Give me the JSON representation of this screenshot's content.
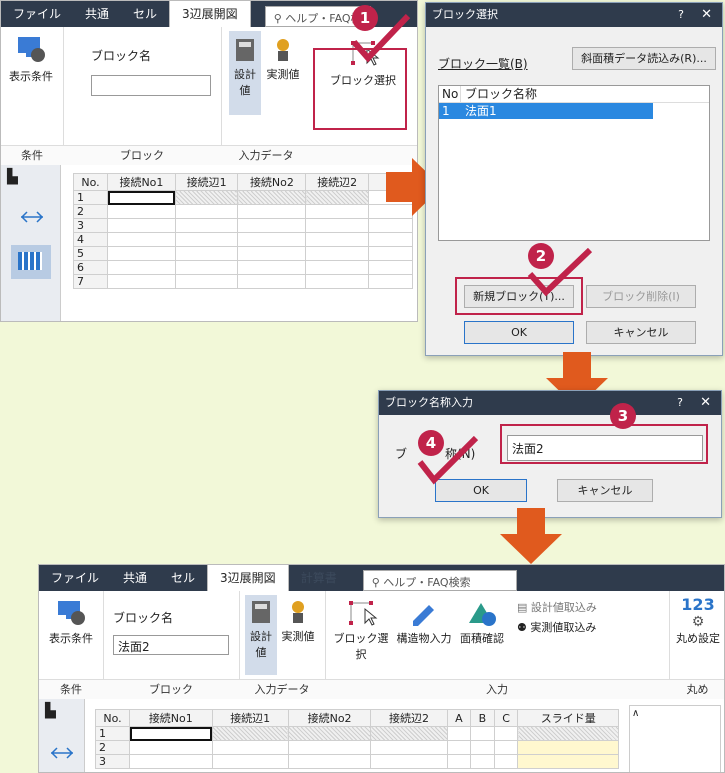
{
  "top": {
    "tabs": [
      "ファイル",
      "共通",
      "セル",
      "3辺展開図",
      "ヘルプ・FAQ検"
    ],
    "cond_label": "表示条件",
    "block_name_label": "ブロック名",
    "block_name_value": "",
    "design_label": "設計値",
    "measured_label": "実測値",
    "block_select_label": "ブロック選択",
    "groups": [
      "条件",
      "ブロック",
      "入力データ"
    ],
    "grid_headers": [
      "No.",
      "接続No1",
      "接続辺1",
      "接続No2",
      "接続辺2"
    ],
    "rows": [
      "1",
      "2",
      "3",
      "4",
      "5",
      "6",
      "7"
    ]
  },
  "dialog_select": {
    "title": "ブロック選択",
    "q": "?",
    "x": "✕",
    "list_label": "ブロック一覧(B)",
    "slope_button": "斜面積データ読込み(R)...",
    "col_no": "No",
    "col_name": "ブロック名称",
    "item_no": "1",
    "item_name": "法面1",
    "new_button": "新規ブロック(T)...",
    "delete_button": "ブロック削除(I)",
    "ok": "OK",
    "cancel": "キャンセル"
  },
  "dialog_name": {
    "title": "ブロック名称入力",
    "q": "?",
    "x": "✕",
    "label_a": "ブ",
    "label_b": "称(N)",
    "value": "法面2",
    "ok": "OK",
    "cancel": "キャンセル"
  },
  "bottom": {
    "tabs": [
      "ファイル",
      "共通",
      "セル",
      "3辺展開図",
      "計算書"
    ],
    "help": "ヘルプ・FAQ検索",
    "cond_label": "表示条件",
    "block_name_label": "ブロック名",
    "block_name_value": "法面2",
    "design_label": "設計値",
    "measured_label": "実測値",
    "block_select": "ブロック選択",
    "structure_input": "構造物入力",
    "area_check": "面積確認",
    "design_import": "設計値取込み",
    "measured_import": "実測値取込み",
    "round": "丸め設定",
    "round_num": "123",
    "groups": [
      "条件",
      "ブロック",
      "入力データ",
      "入力",
      "丸め"
    ],
    "grid_headers": [
      "No.",
      "接続No1",
      "接続辺1",
      "接続No2",
      "接続辺2",
      "A",
      "B",
      "C",
      "スライド量"
    ],
    "rows": [
      "1",
      "2",
      "3"
    ]
  },
  "badges": [
    "1",
    "2",
    "3",
    "4"
  ],
  "colors": {
    "accent": "#c0234a",
    "arrow": "#e05a1e",
    "title_bar": "#2f3b4c",
    "background": "#f2f8d8"
  }
}
